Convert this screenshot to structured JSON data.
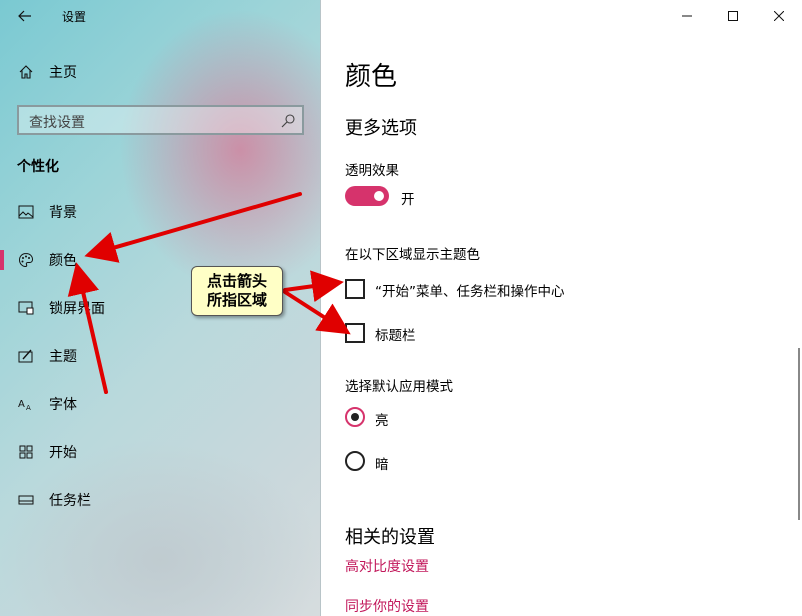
{
  "app": {
    "title": "设置"
  },
  "sidebar": {
    "home": "主页",
    "search_placeholder": "查找设置",
    "section": "个性化",
    "items": [
      {
        "label": "背景",
        "icon": "picture-icon"
      },
      {
        "label": "颜色",
        "icon": "palette-icon",
        "active": true
      },
      {
        "label": "锁屏界面",
        "icon": "lockscreen-icon"
      },
      {
        "label": "主题",
        "icon": "theme-icon"
      },
      {
        "label": "字体",
        "icon": "font-icon"
      },
      {
        "label": "开始",
        "icon": "start-icon"
      },
      {
        "label": "任务栏",
        "icon": "taskbar-icon"
      }
    ]
  },
  "main": {
    "title": "颜色",
    "more_options": "更多选项",
    "transparency": {
      "label": "透明效果",
      "state": "开",
      "on": true
    },
    "accent_surfaces": {
      "label": "在以下区域显示主题色",
      "start_taskbar": "“开始”菜单、任务栏和操作中心",
      "title_bars": "标题栏"
    },
    "app_mode": {
      "label": "选择默认应用模式",
      "light": "亮",
      "dark": "暗",
      "selected": "亮"
    },
    "related": {
      "heading": "相关的设置",
      "high_contrast": "高对比度设置",
      "sync": "同步你的设置"
    }
  },
  "annotation": {
    "line1": "点击箭头",
    "line2": "所指区域"
  },
  "colors": {
    "accent": "#d6336c",
    "link": "#c2185b",
    "callout_bg": "#ffffc6",
    "arrow": "#e00000"
  }
}
